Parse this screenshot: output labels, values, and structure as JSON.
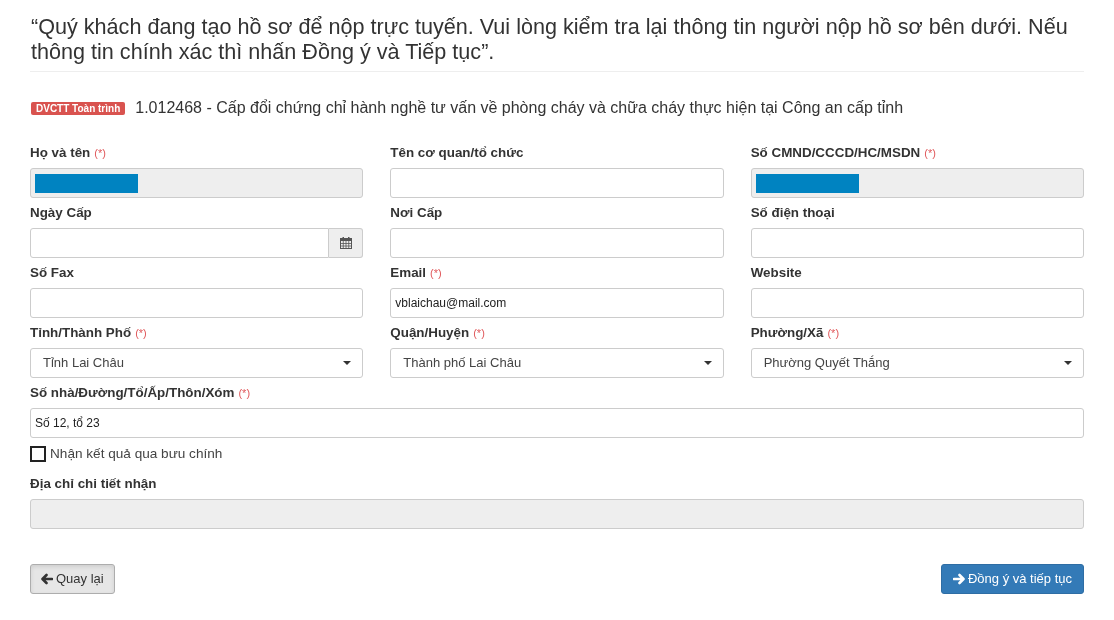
{
  "notice": "“Quý khách đang tạo hồ sơ để nộp trực tuyến. Vui lòng kiểm tra lại thông tin người nộp hồ sơ bên dưới. Nếu thông tin chính xác thì nhấn Đồng ý và Tiếp tục”.",
  "procedure": {
    "badge": "DVCTT Toàn trình",
    "title": "1.012468 - Cấp đổi chứng chỉ hành nghề tư vấn về phòng cháy và chữa cháy thực hiện tại Công an cấp tỉnh"
  },
  "fields": [
    {
      "kind": "text",
      "label": "Họ và tên",
      "required_mark": "(*)",
      "disabled": true,
      "redacted": true
    },
    {
      "kind": "text",
      "label": "Tên cơ quan/tổ chức",
      "disabled": false,
      "redacted": false
    },
    {
      "kind": "text",
      "label": "Số CMND/CCCD/HC/MSDN",
      "required_mark": "(*)",
      "disabled": true,
      "redacted": true
    },
    {
      "kind": "date",
      "label": "Ngày Cấp",
      "disabled": false,
      "redacted": false
    },
    {
      "kind": "text",
      "label": "Nơi Cấp",
      "disabled": false,
      "redacted": false
    },
    {
      "kind": "text",
      "label": "Số điện thoại",
      "disabled": false,
      "redacted": false
    },
    {
      "kind": "text",
      "label": "Số Fax",
      "disabled": false,
      "redacted": false
    },
    {
      "kind": "text",
      "label": "Email",
      "required_mark": "(*)",
      "value": "vblaichau@mail.com",
      "disabled": false,
      "redacted": false
    },
    {
      "kind": "text",
      "label": "Website",
      "disabled": false,
      "redacted": false
    },
    {
      "kind": "select",
      "label": "Tỉnh/Thành Phố",
      "required_mark": "(*)",
      "value": "Tỉnh Lai Châu"
    },
    {
      "kind": "select",
      "label": "Quận/Huyện",
      "required_mark": "(*)",
      "value": "Thành phố Lai Châu"
    },
    {
      "kind": "select",
      "label": "Phường/Xã",
      "required_mark": "(*)",
      "value": "Phường Quyết Thắng"
    }
  ],
  "address_fields": [
    {
      "kind": "text",
      "label": "Số nhà/Đường/Tổ/Ấp/Thôn/Xóm",
      "required_mark": "(*)",
      "value": "Số 12, tổ 23",
      "disabled": false,
      "redacted": false
    },
    {
      "kind": "checkbox",
      "label": "Nhận kết quả qua bưu chính",
      "checked": false
    },
    {
      "kind": "text",
      "label": "Địa chỉ chi tiết nhận",
      "disabled": true,
      "redacted": false
    }
  ],
  "buttons": [
    {
      "kind": "back",
      "label": "Quay lại"
    },
    {
      "kind": "primary",
      "label": "Đồng ý và tiếp tục"
    }
  ]
}
